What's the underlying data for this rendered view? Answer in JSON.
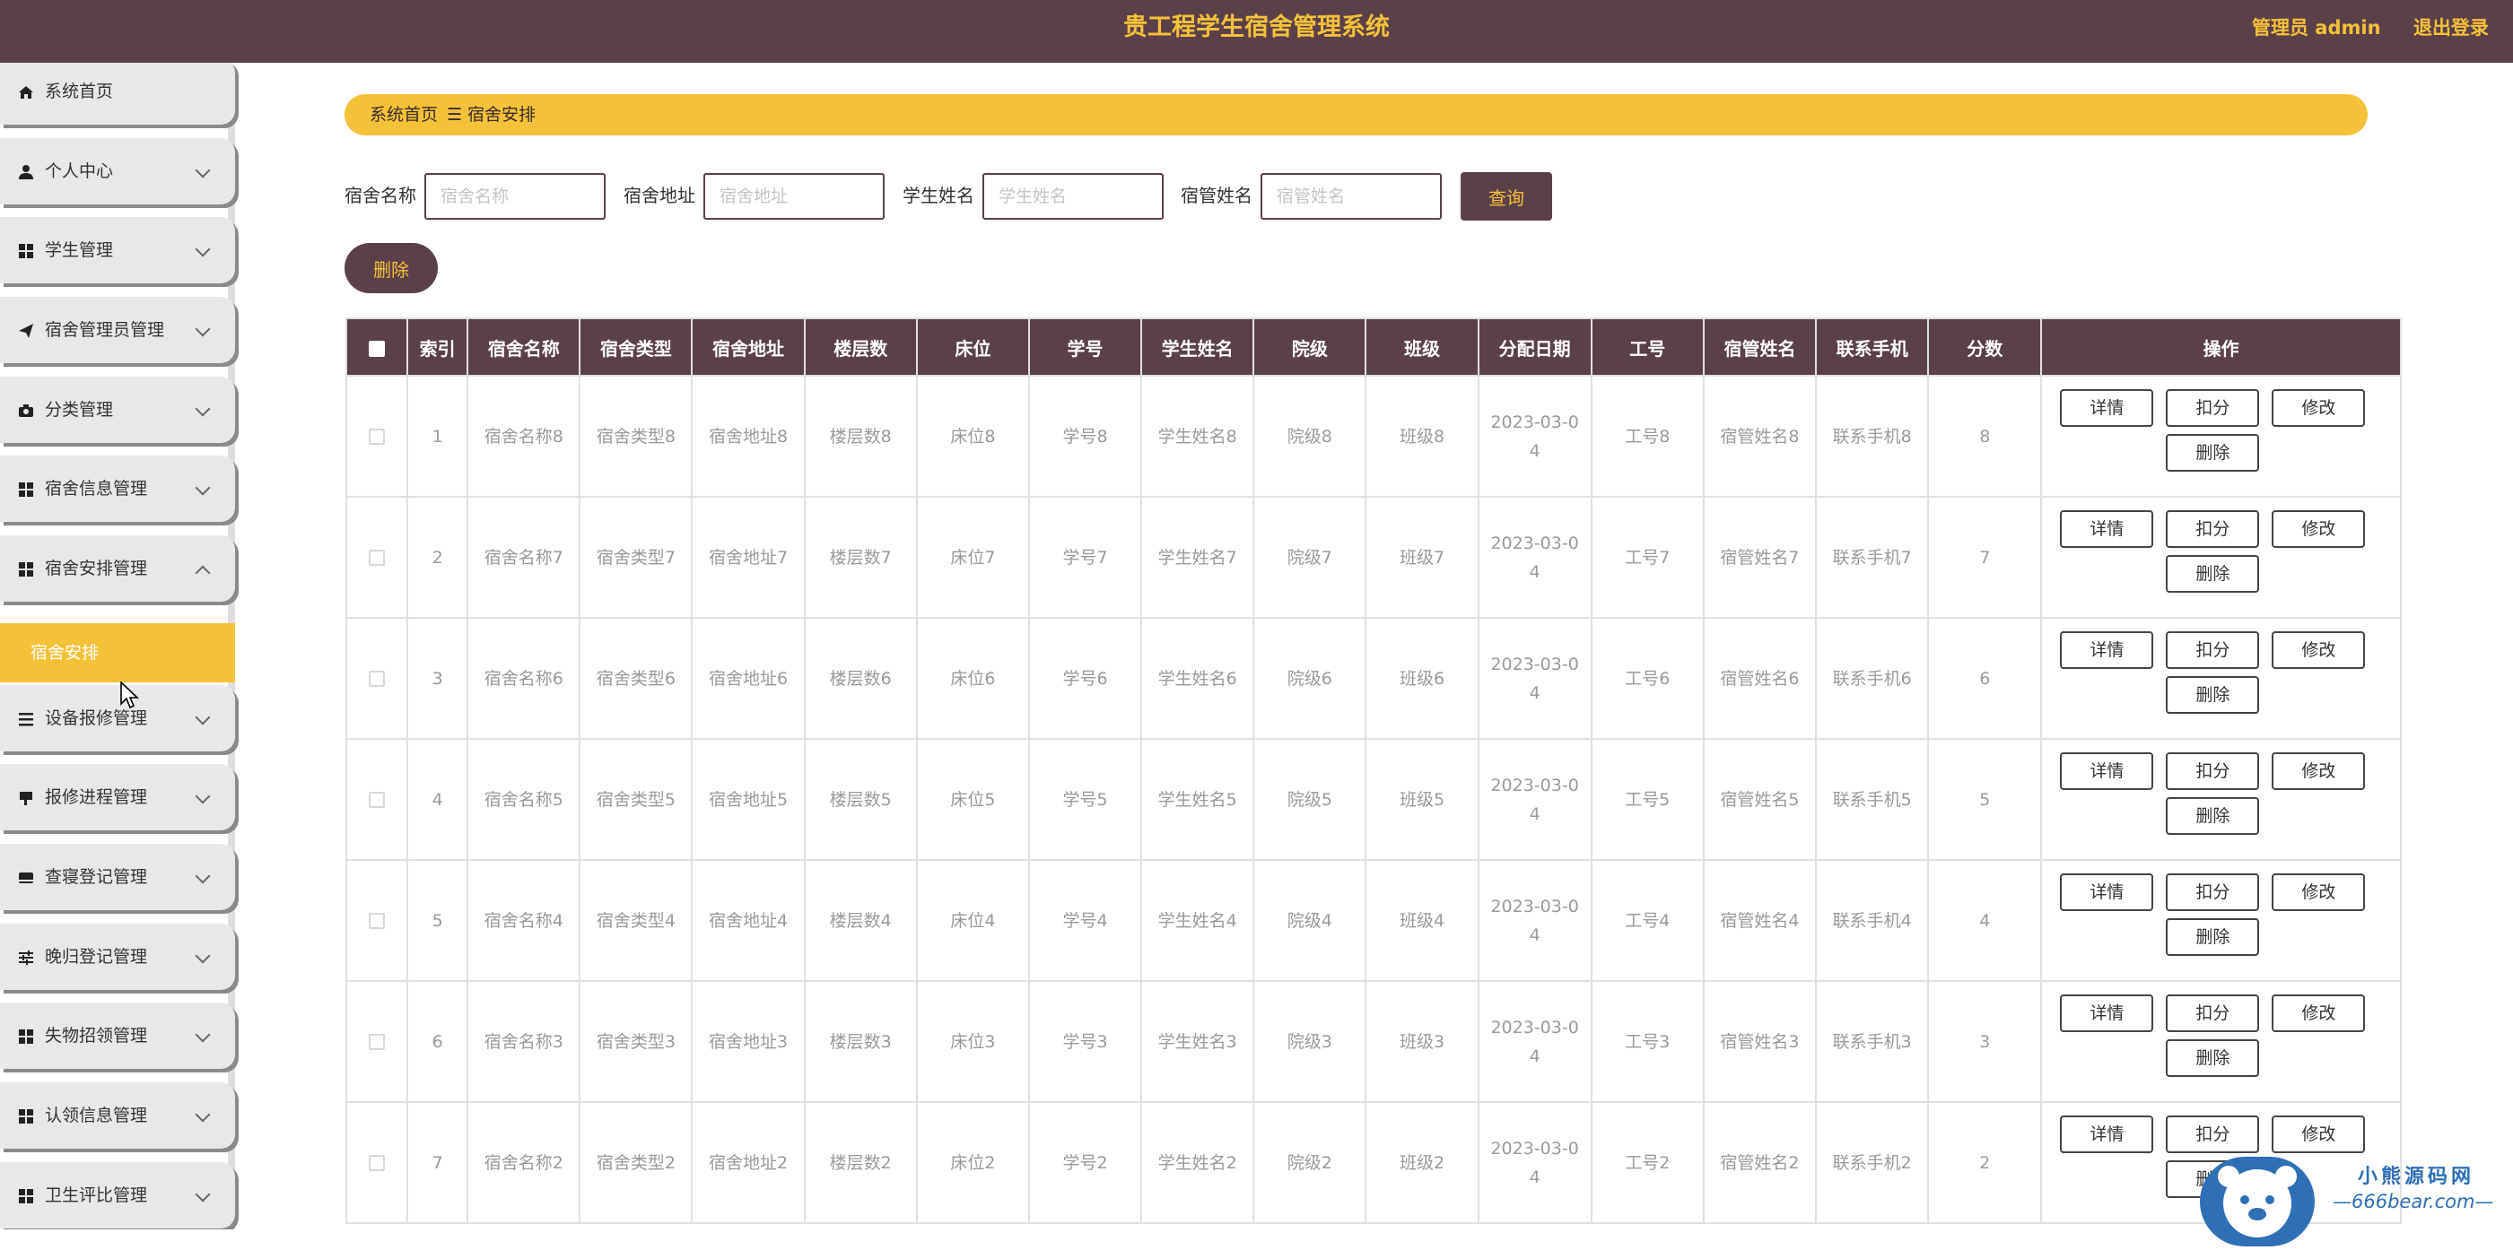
{
  "header": {
    "title": "贵工程学生宿舍管理系统",
    "admin": "管理员 admin",
    "logout": "退出登录"
  },
  "sidebar": {
    "items": [
      {
        "label": "系统首页",
        "icon": "home-icon"
      },
      {
        "label": "个人中心",
        "icon": "user-icon"
      },
      {
        "label": "学生管理",
        "icon": "grid-icon"
      },
      {
        "label": "宿舍管理员管理",
        "icon": "send-icon"
      },
      {
        "label": "分类管理",
        "icon": "camera-icon"
      },
      {
        "label": "宿舍信息管理",
        "icon": "grid-icon"
      },
      {
        "label": "宿舍安排管理",
        "icon": "grid-icon"
      },
      {
        "label": "设备报修管理",
        "icon": "list-icon"
      },
      {
        "label": "报修进程管理",
        "icon": "flag-icon"
      },
      {
        "label": "查寝登记管理",
        "icon": "card-icon"
      },
      {
        "label": "晚归登记管理",
        "icon": "sliders-icon"
      },
      {
        "label": "失物招领管理",
        "icon": "grid-icon"
      },
      {
        "label": "认领信息管理",
        "icon": "grid-icon"
      },
      {
        "label": "卫生评比管理",
        "icon": "grid-icon"
      }
    ],
    "active_sub": "宿舍安排"
  },
  "breadcrumb": {
    "home": "系统首页",
    "sep": "☰",
    "current": "宿舍安排"
  },
  "search": {
    "dorm_name_label": "宿舍名称",
    "dorm_name_placeholder": "宿舍名称",
    "dorm_addr_label": "宿舍地址",
    "dorm_addr_placeholder": "宿舍地址",
    "student_label": "学生姓名",
    "student_placeholder": "学生姓名",
    "manager_label": "宿管姓名",
    "manager_placeholder": "宿管姓名",
    "query": "查询"
  },
  "toolbar": {
    "delete": "删除"
  },
  "table": {
    "headers": [
      "索引",
      "宿舍名称",
      "宿舍类型",
      "宿舍地址",
      "楼层数",
      "床位",
      "学号",
      "学生姓名",
      "院级",
      "班级",
      "分配日期",
      "工号",
      "宿管姓名",
      "联系手机",
      "分数",
      "操作"
    ],
    "rows": [
      {
        "idx": "1",
        "name": "宿舍名称8",
        "type": "宿舍类型8",
        "addr": "宿舍地址8",
        "floor": "楼层数8",
        "bed": "床位8",
        "sno": "学号8",
        "sname": "学生姓名8",
        "college": "院级8",
        "cls": "班级8",
        "date1": "2023-03-0",
        "date2": "4",
        "jobno": "工号8",
        "mname": "宿管姓名8",
        "phone": "联系手机8",
        "score": "8"
      },
      {
        "idx": "2",
        "name": "宿舍名称7",
        "type": "宿舍类型7",
        "addr": "宿舍地址7",
        "floor": "楼层数7",
        "bed": "床位7",
        "sno": "学号7",
        "sname": "学生姓名7",
        "college": "院级7",
        "cls": "班级7",
        "date1": "2023-03-0",
        "date2": "4",
        "jobno": "工号7",
        "mname": "宿管姓名7",
        "phone": "联系手机7",
        "score": "7"
      },
      {
        "idx": "3",
        "name": "宿舍名称6",
        "type": "宿舍类型6",
        "addr": "宿舍地址6",
        "floor": "楼层数6",
        "bed": "床位6",
        "sno": "学号6",
        "sname": "学生姓名6",
        "college": "院级6",
        "cls": "班级6",
        "date1": "2023-03-0",
        "date2": "4",
        "jobno": "工号6",
        "mname": "宿管姓名6",
        "phone": "联系手机6",
        "score": "6"
      },
      {
        "idx": "4",
        "name": "宿舍名称5",
        "type": "宿舍类型5",
        "addr": "宿舍地址5",
        "floor": "楼层数5",
        "bed": "床位5",
        "sno": "学号5",
        "sname": "学生姓名5",
        "college": "院级5",
        "cls": "班级5",
        "date1": "2023-03-0",
        "date2": "4",
        "jobno": "工号5",
        "mname": "宿管姓名5",
        "phone": "联系手机5",
        "score": "5"
      },
      {
        "idx": "5",
        "name": "宿舍名称4",
        "type": "宿舍类型4",
        "addr": "宿舍地址4",
        "floor": "楼层数4",
        "bed": "床位4",
        "sno": "学号4",
        "sname": "学生姓名4",
        "college": "院级4",
        "cls": "班级4",
        "date1": "2023-03-0",
        "date2": "4",
        "jobno": "工号4",
        "mname": "宿管姓名4",
        "phone": "联系手机4",
        "score": "4"
      },
      {
        "idx": "6",
        "name": "宿舍名称3",
        "type": "宿舍类型3",
        "addr": "宿舍地址3",
        "floor": "楼层数3",
        "bed": "床位3",
        "sno": "学号3",
        "sname": "学生姓名3",
        "college": "院级3",
        "cls": "班级3",
        "date1": "2023-03-0",
        "date2": "4",
        "jobno": "工号3",
        "mname": "宿管姓名3",
        "phone": "联系手机3",
        "score": "3"
      },
      {
        "idx": "7",
        "name": "宿舍名称2",
        "type": "宿舍类型2",
        "addr": "宿舍地址2",
        "floor": "楼层数2",
        "bed": "床位2",
        "sno": "学号2",
        "sname": "学生姓名2",
        "college": "院级2",
        "cls": "班级2",
        "date1": "2023-03-0",
        "date2": "4",
        "jobno": "工号2",
        "mname": "宿管姓名2",
        "phone": "联系手机2",
        "score": "2"
      }
    ],
    "ops": {
      "detail": "详情",
      "deduct": "扣分",
      "edit": "修改",
      "delete": "删除"
    }
  },
  "watermark": {
    "line1": "小熊源码网",
    "line2": "—666bear.com—"
  },
  "colors": {
    "header_bg": "#5a4149",
    "accent": "#f6c13a"
  }
}
